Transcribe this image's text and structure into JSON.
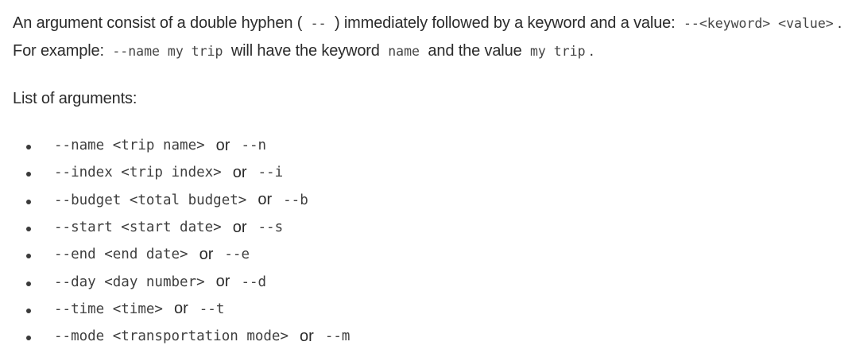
{
  "intro": {
    "text1": "An argument consist of a double hyphen (",
    "code_hyphen": "--",
    "text2": ") immediately followed by a keyword and a value:",
    "code_format": "--<keyword> <value>",
    "text3": ". For example:",
    "code_example": "--name my trip",
    "text4": "will have the keyword",
    "code_keyword": "name",
    "text5": "and the value",
    "code_value": "my trip",
    "text6": "."
  },
  "list_heading": "List of arguments:",
  "or_word": "or",
  "arguments": [
    {
      "long": "--name <trip name>",
      "short": "--n"
    },
    {
      "long": "--index <trip index>",
      "short": "--i"
    },
    {
      "long": "--budget <total budget>",
      "short": "--b"
    },
    {
      "long": "--start <start date>",
      "short": "--s"
    },
    {
      "long": "--end <end date>",
      "short": "--e"
    },
    {
      "long": "--day <day number>",
      "short": "--d"
    },
    {
      "long": "--time <time>",
      "short": "--t"
    },
    {
      "long": "--mode <transportation mode>",
      "short": "--m"
    }
  ]
}
